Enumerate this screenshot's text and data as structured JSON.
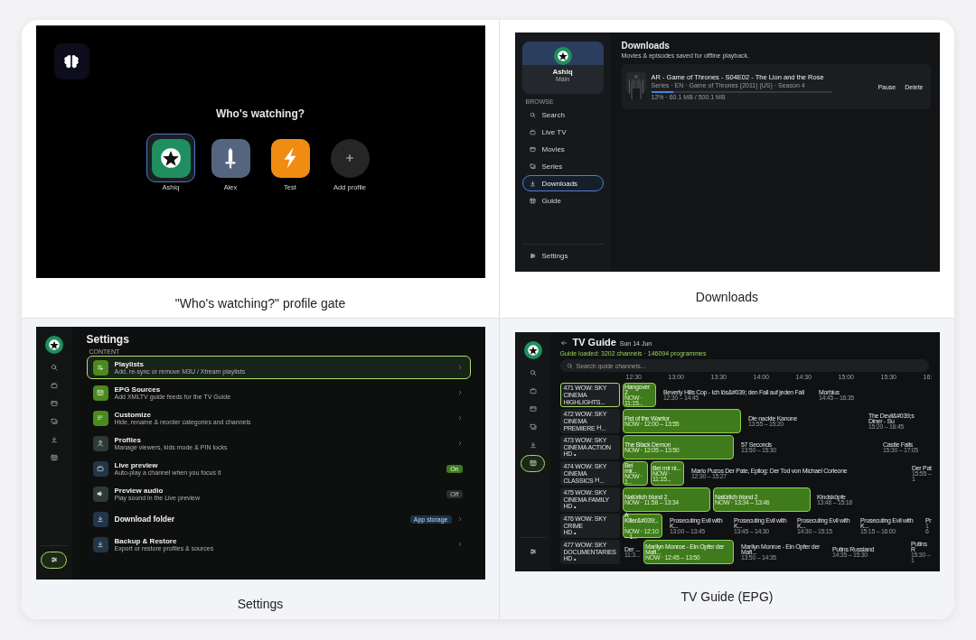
{
  "profile_gate": {
    "caption": "\"Who's watching?\" profile gate",
    "heading": "Who's watching?",
    "profiles": [
      {
        "name": "Ashiq",
        "kind": "star",
        "color": "#1f8f5f",
        "selected": true
      },
      {
        "name": "Alex",
        "kind": "sword",
        "color": "#56657f",
        "selected": false
      },
      {
        "name": "Test",
        "kind": "bolt",
        "color": "#f08c12",
        "selected": false
      },
      {
        "name": "Add profile",
        "kind": "add",
        "color": "#262626",
        "selected": false
      }
    ]
  },
  "downloads": {
    "caption": "Downloads",
    "profile": {
      "name": "Ashiq",
      "role": "Main"
    },
    "section_label": "BROWSE",
    "nav": [
      {
        "kind": "search",
        "label": "Search",
        "selected": false
      },
      {
        "kind": "tv",
        "label": "Live TV",
        "selected": false
      },
      {
        "kind": "movies",
        "label": "Movies",
        "selected": false
      },
      {
        "kind": "series",
        "label": "Series",
        "selected": false
      },
      {
        "kind": "downloads",
        "label": "Downloads",
        "selected": true
      },
      {
        "kind": "guide",
        "label": "Guide",
        "selected": false
      }
    ],
    "settings": {
      "kind": "settings",
      "label": "Settings",
      "selected": false
    },
    "title": "Downloads",
    "subtitle": "Movies & episodes saved for offline playback.",
    "items": [
      {
        "title": "AR - Game of Thrones - S04E02 - The Lion and the Rose",
        "meta": "Series · EN · Game of Thrones (2011) (US) · Season 4",
        "level": 0.12,
        "progress": "12% · 60.1 MB / 500.1 MB",
        "actions": [
          "Pause",
          "Delete"
        ]
      }
    ]
  },
  "settings": {
    "caption": "Settings",
    "rail": [
      {
        "kind": "search",
        "selected": false
      },
      {
        "kind": "tv",
        "selected": false
      },
      {
        "kind": "movies",
        "selected": false
      },
      {
        "kind": "series",
        "selected": false
      },
      {
        "kind": "downloads",
        "selected": false
      },
      {
        "kind": "guide",
        "selected": false
      }
    ],
    "rail_settings": {
      "kind": "settings",
      "selected": true
    },
    "title": "Settings",
    "section": "CONTENT",
    "rows": [
      {
        "kind": "link",
        "color": "#4a8a1e",
        "title": "Playlists",
        "subtitle": "Add, re-sync or remove M3U / Xtream playlists",
        "selected": true
      },
      {
        "kind": "link",
        "color": "#4a8a1e",
        "title": "EPG Sources",
        "subtitle": "Add XMLTV guide feeds for the TV Guide",
        "selected": false
      },
      {
        "kind": "link",
        "color": "#4a8a1e",
        "title": "Customize",
        "subtitle": "Hide, rename & reorder categories and channels",
        "selected": false
      },
      {
        "kind": "link",
        "color": "#2d3b34",
        "title": "Profiles",
        "subtitle": "Manage viewers, kids mode & PIN locks",
        "selected": false
      },
      {
        "kind": "toggle",
        "color": "#233548",
        "title": "Live preview",
        "subtitle": "Auto-play a channel when you focus it",
        "on": true,
        "value": "On",
        "selected": false
      },
      {
        "kind": "toggle",
        "color": "#2d3b34",
        "title": "Preview audio",
        "subtitle": "Play sound in the Live preview",
        "on": false,
        "value": "Off",
        "selected": false
      },
      {
        "kind": "link",
        "color": "#233548",
        "title": "Download folder",
        "badge": "App storage",
        "selected": false
      },
      {
        "kind": "link",
        "color": "#233548",
        "title": "Backup & Restore",
        "subtitle": "Export or restore profiles & sources",
        "selected": false
      }
    ]
  },
  "tv_guide": {
    "caption": "TV Guide (EPG)",
    "rail": [
      {
        "kind": "search",
        "selected": false
      },
      {
        "kind": "tv",
        "selected": false
      },
      {
        "kind": "movies",
        "selected": false
      },
      {
        "kind": "series",
        "selected": false
      },
      {
        "kind": "downloads",
        "selected": false
      },
      {
        "kind": "guide",
        "selected": true
      }
    ],
    "rail_settings": {
      "kind": "settings",
      "selected": false
    },
    "title": "TV Guide",
    "date": "Sun 14 Jun",
    "status": "Guide loaded: 3202 channels · 146094 programmes",
    "search_placeholder": "Search guide channels...",
    "times": [
      "12:30",
      "13:00",
      "13:30",
      "14:00",
      "14:30",
      "15:00",
      "15:30",
      "16:"
    ],
    "channels": [
      {
        "name": "471 WOW: SKY\nCINEMA HIGHLIGHTS...",
        "selected": true,
        "programmes": [
          {
            "title": "Hangover 2",
            "time": "NOW · 11:15...",
            "now": true
          },
          {
            "title": "Beverly Hills Cop - Ich lös&#039; den Fall auf jeden Fall",
            "time": "12:30 – 14:45",
            "now": false
          },
          {
            "title": "Morbius",
            "time": "14:45 – 16:35",
            "now": false
          }
        ]
      },
      {
        "name": "472 WOW: SKY\nCINEMA PREMIERE $^{H}$...",
        "selected": false,
        "programmes": [
          {
            "title": "Fist of the Warrior",
            "time": "NOW · 12:00 – 13:55",
            "now": true
          },
          {
            "title": "Die nackte Kanone",
            "time": "13:55 – 15:20",
            "now": false
          },
          {
            "title": "The Devil&#039;s Diner - Su",
            "time": "15:20 – 16:45",
            "now": false
          }
        ]
      },
      {
        "name": "473 WOW: SKY\nCINEMA ACTION $^{HD}$ •",
        "selected": false,
        "programmes": [
          {
            "title": "The Black Demon",
            "time": "NOW · 12:05 – 13:50",
            "now": true
          },
          {
            "title": "57 Seconds",
            "time": "13:50 – 15:30",
            "now": false
          },
          {
            "title": "Castle Falls",
            "time": "15:30 – 17:05",
            "now": false
          }
        ]
      },
      {
        "name": "474 WOW: SKY\nCINEMA CLASSICS $^{H}$...",
        "selected": false,
        "programmes": [
          {
            "title": "Bei mir...",
            "time": "NOW · 1...",
            "now": true
          },
          {
            "title": "Bei mir ni...",
            "time": "NOW · 11:15...",
            "now": true
          },
          {
            "title": "Mario Puzos Der Pate, Epilog: Der Tod von Michael Corleone",
            "time": "12:30 – 15:27",
            "now": false
          },
          {
            "title": "Der Pat",
            "time": "15:55 – 1",
            "now": false
          }
        ]
      },
      {
        "name": "475 WOW: SKY\nCINEMA FAMILY $^{HD}$ •",
        "selected": false,
        "programmes": [
          {
            "title": "Natürlich blond 2",
            "time": "NOW · 11:58 – 13:34",
            "now": true
          },
          {
            "title": "Natürlich blond 2",
            "time": "NOW · 13:34 – 13:46",
            "now": true
          },
          {
            "title": "Kindsköpfe",
            "time": "13:46 – 15:18",
            "now": false
          }
        ]
      },
      {
        "name": "476 WOW: SKY CRIME\n$^{HD}$ •",
        "selected": false,
        "programmes": [
          {
            "title": "A Killer&#039;...",
            "time": "NOW · 12:10 – 1...",
            "now": true
          },
          {
            "title": "Prosecuting Evil with K...",
            "time": "13:00 – 13:45",
            "now": false
          },
          {
            "title": "Prosecuting Evil with K...",
            "time": "13:45 – 14:30",
            "now": false
          },
          {
            "title": "Prosecuting Evil with K...",
            "time": "14:30 – 15:15",
            "now": false
          },
          {
            "title": "Prosecuting Evil with K...",
            "time": "15:15 – 16:00",
            "now": false
          },
          {
            "title": "Pr",
            "time": "16",
            "now": false
          }
        ]
      },
      {
        "name": "477 WOW: SKY\nDOCUMENTARIES $^{HD}$ •",
        "selected": false,
        "programmes": [
          {
            "title": "Der ...",
            "time": "11:3...",
            "now": false
          },
          {
            "title": "Marilyn Monroe - Ein Opfer der Mafi...",
            "time": "NOW · 12:45 – 13:50",
            "now": true
          },
          {
            "title": "Marilyn Monroe - Ein Opfer der Mafi...",
            "time": "13:50 – 14:35",
            "now": false
          },
          {
            "title": "Putins Russland",
            "time": "14:35 – 15:30",
            "now": false
          },
          {
            "title": "Putins R",
            "time": "15:30 – 1",
            "now": false
          }
        ]
      }
    ]
  }
}
